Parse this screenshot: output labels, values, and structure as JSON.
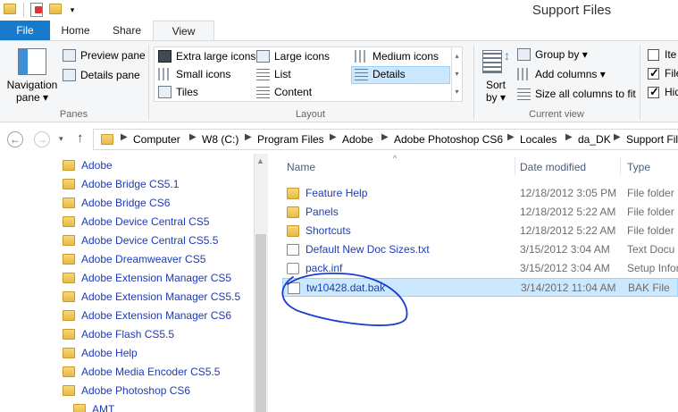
{
  "window": {
    "title": "Support Files"
  },
  "tabs": [
    {
      "label": "File"
    },
    {
      "label": "Home"
    },
    {
      "label": "Share"
    },
    {
      "label": "View"
    }
  ],
  "ribbon": {
    "panes_group": {
      "label": "Panes",
      "navigation_pane": "Navigation",
      "navigation_pane_2": "pane ▾",
      "preview_pane": "Preview pane",
      "details_pane": "Details pane"
    },
    "layout_group": {
      "label": "Layout",
      "items": [
        "Extra large icons",
        "Large icons",
        "Medium icons",
        "Small icons",
        "List",
        "Details",
        "Tiles",
        "Content"
      ]
    },
    "current_view_group": {
      "label": "Current view",
      "sort_by": "Sort",
      "sort_by_2": "by ▾",
      "group_by": "Group by ▾",
      "add_columns": "Add columns ▾",
      "size_all": "Size all columns to fit"
    },
    "show_hide_group": {
      "items": [
        "Ite",
        "File",
        "Hid"
      ]
    }
  },
  "address": {
    "crumbs": [
      "Computer",
      "W8 (C:)",
      "Program Files",
      "Adobe",
      "Adobe Photoshop CS6",
      "Locales",
      "da_DK",
      "Support Fil"
    ]
  },
  "nav": {
    "items": [
      "Adobe",
      "Adobe Bridge CS5.1",
      "Adobe Bridge CS6",
      "Adobe Device Central CS5",
      "Adobe Device Central CS5.5",
      "Adobe Dreamweaver CS5",
      "Adobe Extension Manager CS5",
      "Adobe Extension Manager CS5.5",
      "Adobe Extension Manager CS6",
      "Adobe Flash CS5.5",
      "Adobe Help",
      "Adobe Media Encoder CS5.5",
      "Adobe Photoshop CS6",
      "AMT"
    ]
  },
  "files": {
    "columns": {
      "name": "Name",
      "date": "Date modified",
      "type": "Type"
    },
    "rows": [
      {
        "name": "Feature Help",
        "date": "12/18/2012 3:05 PM",
        "type": "File folder",
        "icon": "folder-icon"
      },
      {
        "name": "Panels",
        "date": "12/18/2012 5:22 AM",
        "type": "File folder",
        "icon": "folder-icon"
      },
      {
        "name": "Shortcuts",
        "date": "12/18/2012 5:22 AM",
        "type": "File folder",
        "icon": "folder-icon"
      },
      {
        "name": "Default New Doc Sizes.txt",
        "date": "3/15/2012 3:04 AM",
        "type": "Text Docu",
        "icon": "text-file-icon"
      },
      {
        "name": "pack.inf",
        "date": "3/15/2012 3:04 AM",
        "type": "Setup Infor",
        "icon": "setup-file-icon"
      },
      {
        "name": "tw10428.dat.bak",
        "date": "3/14/2012 11:04 AM",
        "type": "BAK File",
        "icon": "file-icon"
      }
    ]
  },
  "colors": {
    "accent": "#1979ca",
    "link": "#1f3bb5",
    "selection": "#cce8ff",
    "annotation": "#1a3bd0"
  }
}
